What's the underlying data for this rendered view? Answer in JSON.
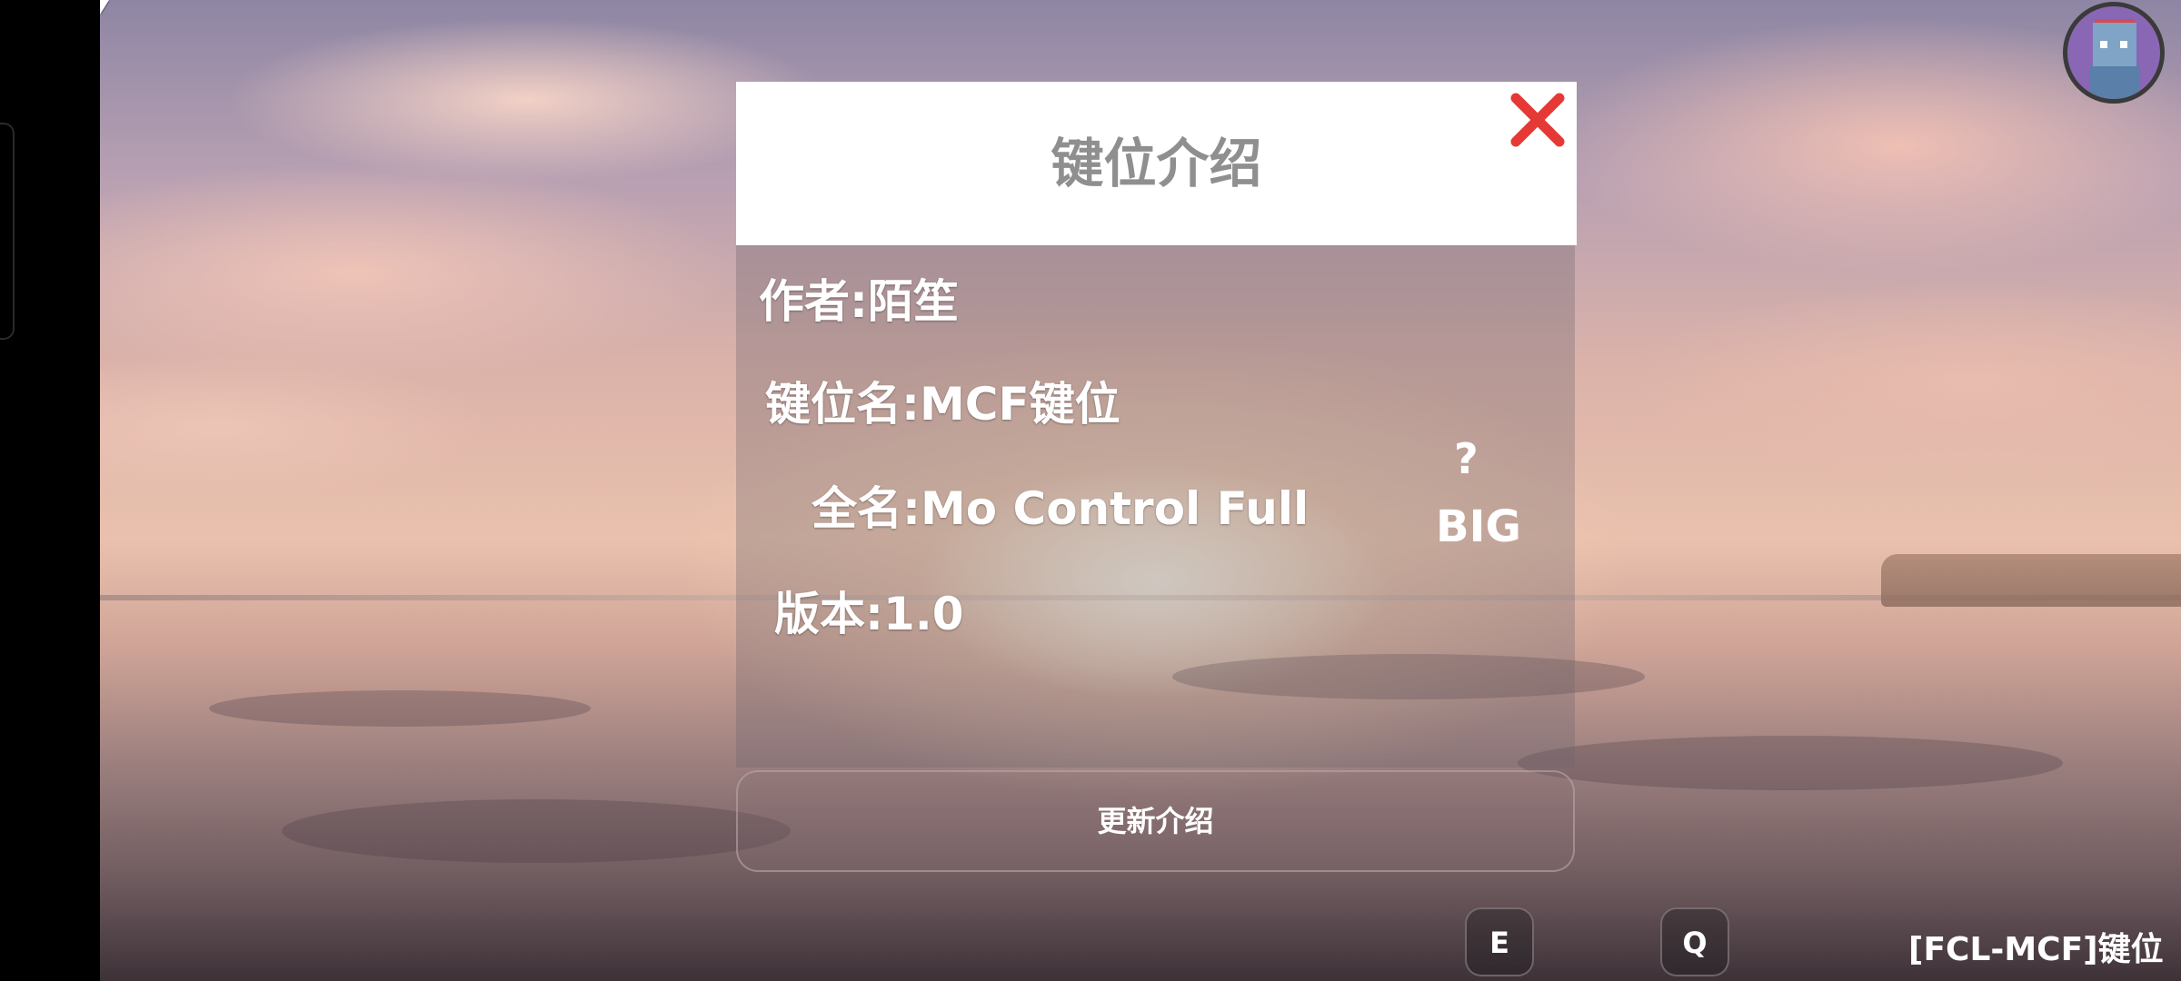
{
  "dialog": {
    "title": "键位介绍",
    "author": "作者:陌笙",
    "layout_name": "键位名:MCF键位",
    "full_name": "全名:Mo Control Full",
    "version": "版本:1.0",
    "help_mark": "?",
    "size_label": "BIG",
    "update_button": "更新介绍"
  },
  "keys": {
    "e": "E",
    "q": "Q"
  },
  "layout_label": "[FCL-MCF]键位",
  "icons": {
    "close": "close-x-icon",
    "avatar": "player-avatar-icon"
  },
  "colors": {
    "close": "#e53935",
    "title": "#8f8f8f"
  }
}
